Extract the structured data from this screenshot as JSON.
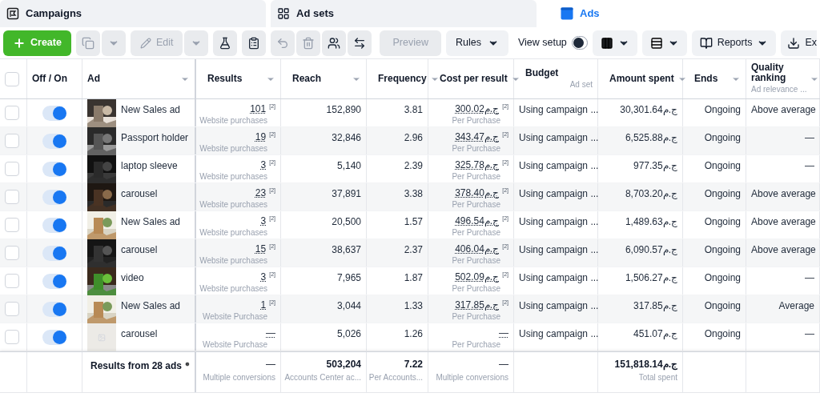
{
  "tabs": [
    {
      "label": "Campaigns",
      "selected": false
    },
    {
      "label": "Ad sets",
      "selected": false
    },
    {
      "label": "Ads",
      "selected": true
    }
  ],
  "toolbar": {
    "create": {
      "label": "Create"
    },
    "duplicate": {
      "disabled": true
    },
    "edit": {
      "label": "Edit",
      "disabled": true
    },
    "undo": {
      "disabled": true
    },
    "delete": {
      "disabled": true
    },
    "preview": {
      "label": "Preview",
      "disabled": true
    },
    "rules": {
      "label": "Rules"
    },
    "view_setup": {
      "label": "View setup",
      "on": false
    },
    "reports": {
      "label": "Reports"
    },
    "export": {
      "label": "Ex"
    }
  },
  "table": {
    "select_all_checked": false,
    "columns": [
      {
        "label": "Off / On"
      },
      {
        "label": "Ad",
        "sort": true
      },
      {
        "label": "Results",
        "sort": true
      },
      {
        "label": "Reach",
        "sort": true
      },
      {
        "label": "Frequency",
        "sort": true
      },
      {
        "label": "Cost per result",
        "sort": true
      },
      {
        "label": "Budget",
        "sub": "Ad set"
      },
      {
        "label": "Amount spent",
        "sort": true
      },
      {
        "label": "Ends",
        "sort": true
      },
      {
        "label": "Quality ranking",
        "sub": "Ad relevance ...",
        "sort": true
      }
    ],
    "rows": [
      {
        "checked": false,
        "on": true,
        "ad": "New Sales ad",
        "results": {
          "value": "101",
          "note": "[2]",
          "label": "Website purchases"
        },
        "reach": "152,890",
        "frequency": "3.81",
        "cost": {
          "value": "300.02ج.م",
          "note": "[2]",
          "label": "Per Purchase"
        },
        "budget": "Using campaign ...",
        "amount": "30,301.64ج.م",
        "ends": "Ongoing",
        "quality": "Above average"
      },
      {
        "checked": false,
        "on": true,
        "ad": "Passport holder",
        "results": {
          "value": "19",
          "note": "[2]",
          "label": "Website purchases"
        },
        "reach": "32,846",
        "frequency": "2.96",
        "cost": {
          "value": "343.47ج.م",
          "note": "[2]",
          "label": "Per Purchase"
        },
        "budget": "Using campaign ...",
        "amount": "6,525.88ج.م",
        "ends": "Ongoing",
        "quality": "—"
      },
      {
        "checked": false,
        "on": true,
        "ad": "laptop sleeve",
        "results": {
          "value": "3",
          "note": "[2]",
          "label": "Website purchases"
        },
        "reach": "5,140",
        "frequency": "2.39",
        "cost": {
          "value": "325.78ج.م",
          "note": "[2]",
          "label": "Per Purchase"
        },
        "budget": "Using campaign ...",
        "amount": "977.35ج.م",
        "ends": "Ongoing",
        "quality": "—"
      },
      {
        "checked": false,
        "on": true,
        "ad": "carousel",
        "results": {
          "value": "23",
          "note": "[2]",
          "label": "Website purchases"
        },
        "reach": "37,891",
        "frequency": "3.38",
        "cost": {
          "value": "378.40ج.م",
          "note": "[2]",
          "label": "Per Purchase"
        },
        "budget": "Using campaign ...",
        "amount": "8,703.20ج.م",
        "ends": "Ongoing",
        "quality": "Above average"
      },
      {
        "checked": false,
        "on": true,
        "ad": "New Sales ad",
        "results": {
          "value": "3",
          "note": "[2]",
          "label": "Website purchases"
        },
        "reach": "20,500",
        "frequency": "1.57",
        "cost": {
          "value": "496.54ج.م",
          "note": "[2]",
          "label": "Per Purchase"
        },
        "budget": "Using campaign ...",
        "amount": "1,489.63ج.م",
        "ends": "Ongoing",
        "quality": "Above average"
      },
      {
        "checked": false,
        "on": true,
        "ad": "carousel",
        "results": {
          "value": "15",
          "note": "[2]",
          "label": "Website purchases"
        },
        "reach": "38,637",
        "frequency": "2.37",
        "cost": {
          "value": "406.04ج.م",
          "note": "[2]",
          "label": "Per Purchase"
        },
        "budget": "Using campaign ...",
        "amount": "6,090.57ج.م",
        "ends": "Ongoing",
        "quality": "Above average"
      },
      {
        "checked": false,
        "on": true,
        "ad": "video",
        "results": {
          "value": "3",
          "note": "[2]",
          "label": "Website purchases"
        },
        "reach": "7,965",
        "frequency": "1.87",
        "cost": {
          "value": "502.09ج.م",
          "note": "[2]",
          "label": "Per Purchase"
        },
        "budget": "Using campaign ...",
        "amount": "1,506.27ج.م",
        "ends": "Ongoing",
        "quality": "—"
      },
      {
        "checked": false,
        "on": true,
        "ad": "New Sales ad",
        "results": {
          "value": "1",
          "note": "[2]",
          "label": "Website Purchase"
        },
        "reach": "3,044",
        "frequency": "1.33",
        "cost": {
          "value": "317.85ج.م",
          "note": "[2]",
          "label": "Per Purchase"
        },
        "budget": "Using campaign ...",
        "amount": "317.85ج.م",
        "ends": "Ongoing",
        "quality": "Average"
      },
      {
        "checked": false,
        "on": true,
        "thumbnail": {
          "kind": "placeholder"
        },
        "ad": "carousel",
        "results": {
          "value": "—",
          "label": "Website Purchase"
        },
        "reach": "5,026",
        "frequency": "1.26",
        "cost": {
          "value": "—",
          "label": "Per Purchase"
        },
        "budget": "Using campaign ...",
        "amount": "451.07ج.م",
        "ends": "Ongoing",
        "quality": "—"
      }
    ],
    "footer": {
      "title": "Results from 28 ads",
      "results": {
        "value": "—",
        "label": "Multiple conversions"
      },
      "reach": {
        "value": "503,204",
        "label": "Accounts Center ac..."
      },
      "frequency": {
        "value": "7.22",
        "label": "Per Accounts..."
      },
      "cost": {
        "value": "—",
        "label": "Multiple conversions"
      },
      "amount": {
        "value": "151,818.14ج.م",
        "label": "Total spent"
      }
    }
  }
}
